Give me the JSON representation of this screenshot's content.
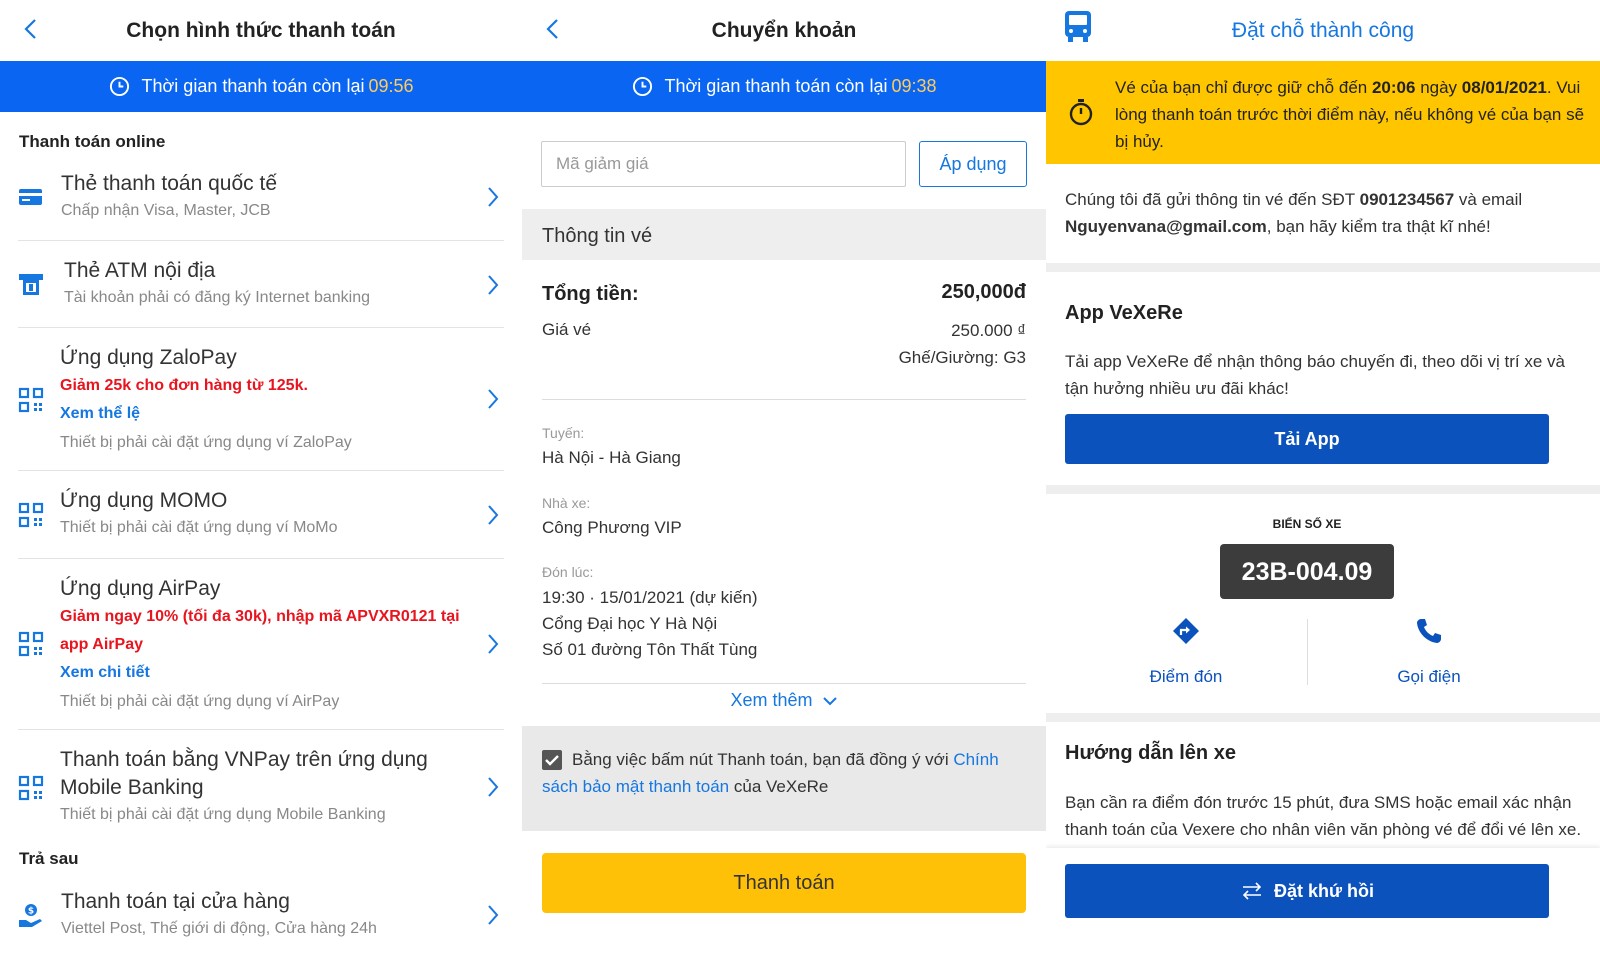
{
  "colors": {
    "primary": "#0a66f2",
    "countdown": "#ffcc5c",
    "promo": "#e8141e",
    "link": "#1677e0",
    "pay_button": "#ffc107",
    "warning": "#ffc600",
    "cta": "#0b52bd"
  },
  "panel1": {
    "title": "Chọn hình thức thanh toán",
    "timer": {
      "label": "Thời gian thanh toán còn lại",
      "value": "09:56"
    },
    "section_online": "Thanh toán online",
    "section_later": "Trả sau",
    "methods": [
      {
        "title": "Thẻ thanh toán quốc tế",
        "subtitle": "Chấp nhận Visa, Master, JCB",
        "icon": "credit-card-icon"
      },
      {
        "title": "Thẻ ATM nội địa",
        "subtitle": "Tài khoản phải có đăng ký Internet banking",
        "icon": "atm-icon"
      },
      {
        "title": "Ứng dụng ZaloPay",
        "promo": "Giảm 25k cho đơn hàng từ 125k.",
        "link": "Xem thể lệ",
        "subtitle": "Thiết bị phải cài đặt ứng dụng ví ZaloPay",
        "icon": "qr-code-icon"
      },
      {
        "title": "Ứng dụng MOMO",
        "subtitle": "Thiết bị phải cài đặt ứng dụng ví MoMo",
        "icon": "qr-code-icon"
      },
      {
        "title": "Ứng dụng AirPay",
        "promo": "Giảm ngay 10% (tối đa 30k), nhập mã APVXR0121 tại app AirPay",
        "link": "Xem chi tiết",
        "subtitle": "Thiết bị phải cài đặt ứng dụng ví AirPay",
        "icon": "qr-code-icon"
      },
      {
        "title": "Thanh toán bằng VNPay trên ứng dụng Mobile Banking",
        "subtitle": "Thiết bị phải cài đặt ứng dụng Mobile Banking",
        "icon": "qr-code-icon"
      },
      {
        "title": "Thanh toán tại cửa hàng",
        "subtitle": "Viettel Post, Thế giới di động, Cửa hàng 24h",
        "icon": "store-payment-icon"
      }
    ]
  },
  "panel2": {
    "title": "Chuyển khoản",
    "timer": {
      "label": "Thời gian thanh toán còn lại",
      "value": "09:38"
    },
    "coupon_placeholder": "Mã giảm giá",
    "apply_label": "Áp dụng",
    "ticket_info_title": "Thông tin vé",
    "total_label": "Tổng tiền:",
    "total_value": "250,000đ",
    "price_label": "Giá vé",
    "price_value": "250.000 ₫",
    "seat": "Ghế/Giường: G3",
    "route_label": "Tuyến:",
    "route_value": "Hà Nội - Hà Giang",
    "operator_label": "Nhà xe:",
    "operator_value": "Công Phương VIP",
    "pickup_label": "Đón lúc:",
    "pickup_time": "19:30 · 15/01/2021 (dự kiến)",
    "pickup_place": "Cổng Đại học Y Hà Nội",
    "pickup_address": "Số 01 đường Tôn Thất Tùng",
    "see_more": "Xem thêm",
    "agree_prefix": "Bằng việc bấm nút Thanh toán, bạn đã đồng ý với",
    "agree_link": "Chính sách bảo mật thanh toán",
    "agree_suffix": "của VeXeRe",
    "pay_label": "Thanh toán"
  },
  "panel3": {
    "title": "Đặt chỗ thành công",
    "warning_1": "Vé của bạn chỉ được giữ chỗ đến",
    "warning_time": "20:06",
    "warning_2": "ngày",
    "warning_date": "08/01/2021",
    "warning_3": ". Vui lòng thanh toán trước thời điểm này, nếu không vé của bạn sẽ bị hủy.",
    "sent_1": "Chúng tôi đã gửi thông tin vé đến SĐT",
    "phone": "0901234567",
    "sent_2": "và email",
    "email": "Nguyenvana@gmail.com",
    "sent_3": ", bạn hãy kiểm tra thật kĩ nhé!",
    "app_title": "App VeXeRe",
    "app_desc": "Tải app VeXeRe để nhận thông báo chuyến đi, theo dõi vị trí xe và tận hưởng nhiều ưu đãi khác!",
    "download_label": "Tải App",
    "plate_label": "BIỂN SỐ XE",
    "plate": "23B-004.09",
    "pickup_label": "Điểm đón",
    "call_label": "Gọi điện",
    "guide_title": "Hướng dẫn lên xe",
    "guide_desc": "Bạn cần ra điểm đón trước 15 phút, đưa SMS hoặc email xác nhận thanh toán của Vexere cho nhân viên văn phòng vé để đổi vé lên xe.",
    "return_label": "Đặt khứ hồi"
  }
}
